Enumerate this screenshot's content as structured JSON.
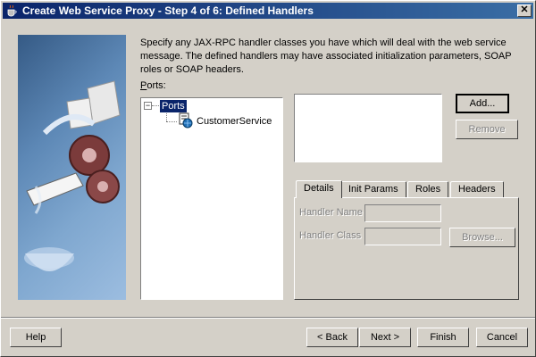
{
  "window": {
    "title": "Create Web Service Proxy - Step 4 of 6: Defined Handlers",
    "close_glyph": "✕"
  },
  "instructions": "Specify any JAX-RPC handler classes you have which will deal with the web service message. The defined handlers may have associated initialization parameters, SOAP roles or SOAP headers.",
  "ports": {
    "label_prefix": "",
    "label_mnemonic": "P",
    "label_rest": "orts:",
    "tree": {
      "root": "Ports",
      "expander": "−",
      "children": [
        "CustomerService"
      ]
    }
  },
  "buttons": {
    "add": "Add...",
    "remove": "Remove",
    "browse": "Browse..."
  },
  "tabs": [
    "Details",
    "Init Params",
    "Roles",
    "Headers"
  ],
  "details": {
    "handler_name_label": "Handler Name",
    "handler_class_label": "Handler Class"
  },
  "footer": {
    "help": "Help",
    "back": "< Back",
    "next": "Next >",
    "finish": "Finish",
    "cancel": "Cancel"
  },
  "icons": {
    "title": "java-coffee-cup-icon",
    "port": "web-service-port-icon",
    "side": "web-service-wizard-illustration"
  }
}
